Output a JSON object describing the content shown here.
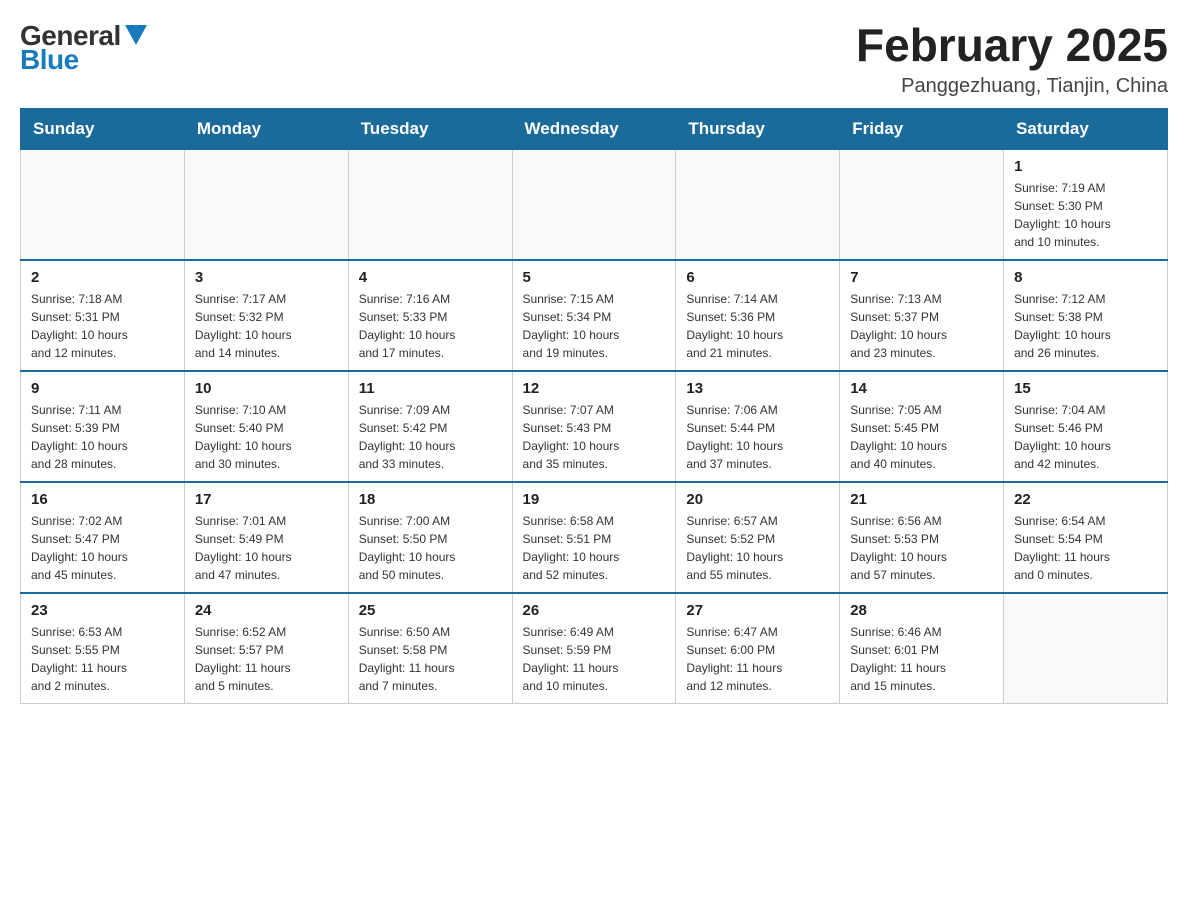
{
  "logo": {
    "general": "General",
    "blue": "Blue"
  },
  "title": "February 2025",
  "location": "Panggezhuang, Tianjin, China",
  "headers": [
    "Sunday",
    "Monday",
    "Tuesday",
    "Wednesday",
    "Thursday",
    "Friday",
    "Saturday"
  ],
  "weeks": [
    [
      {
        "day": "",
        "info": ""
      },
      {
        "day": "",
        "info": ""
      },
      {
        "day": "",
        "info": ""
      },
      {
        "day": "",
        "info": ""
      },
      {
        "day": "",
        "info": ""
      },
      {
        "day": "",
        "info": ""
      },
      {
        "day": "1",
        "info": "Sunrise: 7:19 AM\nSunset: 5:30 PM\nDaylight: 10 hours\nand 10 minutes."
      }
    ],
    [
      {
        "day": "2",
        "info": "Sunrise: 7:18 AM\nSunset: 5:31 PM\nDaylight: 10 hours\nand 12 minutes."
      },
      {
        "day": "3",
        "info": "Sunrise: 7:17 AM\nSunset: 5:32 PM\nDaylight: 10 hours\nand 14 minutes."
      },
      {
        "day": "4",
        "info": "Sunrise: 7:16 AM\nSunset: 5:33 PM\nDaylight: 10 hours\nand 17 minutes."
      },
      {
        "day": "5",
        "info": "Sunrise: 7:15 AM\nSunset: 5:34 PM\nDaylight: 10 hours\nand 19 minutes."
      },
      {
        "day": "6",
        "info": "Sunrise: 7:14 AM\nSunset: 5:36 PM\nDaylight: 10 hours\nand 21 minutes."
      },
      {
        "day": "7",
        "info": "Sunrise: 7:13 AM\nSunset: 5:37 PM\nDaylight: 10 hours\nand 23 minutes."
      },
      {
        "day": "8",
        "info": "Sunrise: 7:12 AM\nSunset: 5:38 PM\nDaylight: 10 hours\nand 26 minutes."
      }
    ],
    [
      {
        "day": "9",
        "info": "Sunrise: 7:11 AM\nSunset: 5:39 PM\nDaylight: 10 hours\nand 28 minutes."
      },
      {
        "day": "10",
        "info": "Sunrise: 7:10 AM\nSunset: 5:40 PM\nDaylight: 10 hours\nand 30 minutes."
      },
      {
        "day": "11",
        "info": "Sunrise: 7:09 AM\nSunset: 5:42 PM\nDaylight: 10 hours\nand 33 minutes."
      },
      {
        "day": "12",
        "info": "Sunrise: 7:07 AM\nSunset: 5:43 PM\nDaylight: 10 hours\nand 35 minutes."
      },
      {
        "day": "13",
        "info": "Sunrise: 7:06 AM\nSunset: 5:44 PM\nDaylight: 10 hours\nand 37 minutes."
      },
      {
        "day": "14",
        "info": "Sunrise: 7:05 AM\nSunset: 5:45 PM\nDaylight: 10 hours\nand 40 minutes."
      },
      {
        "day": "15",
        "info": "Sunrise: 7:04 AM\nSunset: 5:46 PM\nDaylight: 10 hours\nand 42 minutes."
      }
    ],
    [
      {
        "day": "16",
        "info": "Sunrise: 7:02 AM\nSunset: 5:47 PM\nDaylight: 10 hours\nand 45 minutes."
      },
      {
        "day": "17",
        "info": "Sunrise: 7:01 AM\nSunset: 5:49 PM\nDaylight: 10 hours\nand 47 minutes."
      },
      {
        "day": "18",
        "info": "Sunrise: 7:00 AM\nSunset: 5:50 PM\nDaylight: 10 hours\nand 50 minutes."
      },
      {
        "day": "19",
        "info": "Sunrise: 6:58 AM\nSunset: 5:51 PM\nDaylight: 10 hours\nand 52 minutes."
      },
      {
        "day": "20",
        "info": "Sunrise: 6:57 AM\nSunset: 5:52 PM\nDaylight: 10 hours\nand 55 minutes."
      },
      {
        "day": "21",
        "info": "Sunrise: 6:56 AM\nSunset: 5:53 PM\nDaylight: 10 hours\nand 57 minutes."
      },
      {
        "day": "22",
        "info": "Sunrise: 6:54 AM\nSunset: 5:54 PM\nDaylight: 11 hours\nand 0 minutes."
      }
    ],
    [
      {
        "day": "23",
        "info": "Sunrise: 6:53 AM\nSunset: 5:55 PM\nDaylight: 11 hours\nand 2 minutes."
      },
      {
        "day": "24",
        "info": "Sunrise: 6:52 AM\nSunset: 5:57 PM\nDaylight: 11 hours\nand 5 minutes."
      },
      {
        "day": "25",
        "info": "Sunrise: 6:50 AM\nSunset: 5:58 PM\nDaylight: 11 hours\nand 7 minutes."
      },
      {
        "day": "26",
        "info": "Sunrise: 6:49 AM\nSunset: 5:59 PM\nDaylight: 11 hours\nand 10 minutes."
      },
      {
        "day": "27",
        "info": "Sunrise: 6:47 AM\nSunset: 6:00 PM\nDaylight: 11 hours\nand 12 minutes."
      },
      {
        "day": "28",
        "info": "Sunrise: 6:46 AM\nSunset: 6:01 PM\nDaylight: 11 hours\nand 15 minutes."
      },
      {
        "day": "",
        "info": ""
      }
    ]
  ]
}
